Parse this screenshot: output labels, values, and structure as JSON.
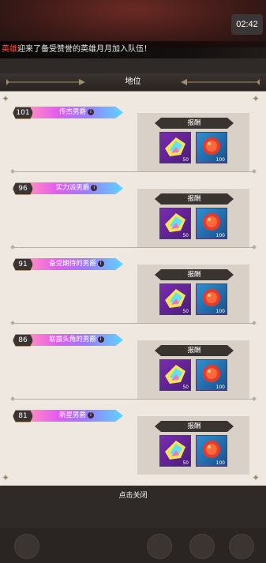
{
  "status": {
    "clock": "02:42"
  },
  "ticker": {
    "name": "英雄",
    "text": "迎来了备受赞誉的英雄月月加入队伍！"
  },
  "panel": {
    "title": "地位",
    "reward_label": "报酬",
    "close_hint": "点击关闭"
  },
  "ranks": [
    {
      "level": "101",
      "title": "传杰男爵",
      "rewards": [
        {
          "icon": "star-crystal-icon",
          "count": "50"
        },
        {
          "icon": "red-orb-icon",
          "count": "100"
        }
      ]
    },
    {
      "level": "96",
      "title": "实力派男爵",
      "rewards": [
        {
          "icon": "star-crystal-icon",
          "count": "50"
        },
        {
          "icon": "red-orb-icon",
          "count": "100"
        }
      ]
    },
    {
      "level": "91",
      "title": "备受期待的男爵",
      "rewards": [
        {
          "icon": "star-crystal-icon",
          "count": "50"
        },
        {
          "icon": "red-orb-icon",
          "count": "100"
        }
      ]
    },
    {
      "level": "86",
      "title": "崭露头角的男爵",
      "rewards": [
        {
          "icon": "star-crystal-icon",
          "count": "50"
        },
        {
          "icon": "red-orb-icon",
          "count": "100"
        }
      ]
    },
    {
      "level": "81",
      "title": "新星男爵",
      "rewards": [
        {
          "icon": "star-crystal-icon",
          "count": "50"
        },
        {
          "icon": "red-orb-icon",
          "count": "100"
        }
      ]
    }
  ],
  "colors": {
    "accent_ticker": "#ff4a3a",
    "rank_bar_start": "#ff8ac4",
    "rank_bar_end": "#5ed4ff"
  }
}
